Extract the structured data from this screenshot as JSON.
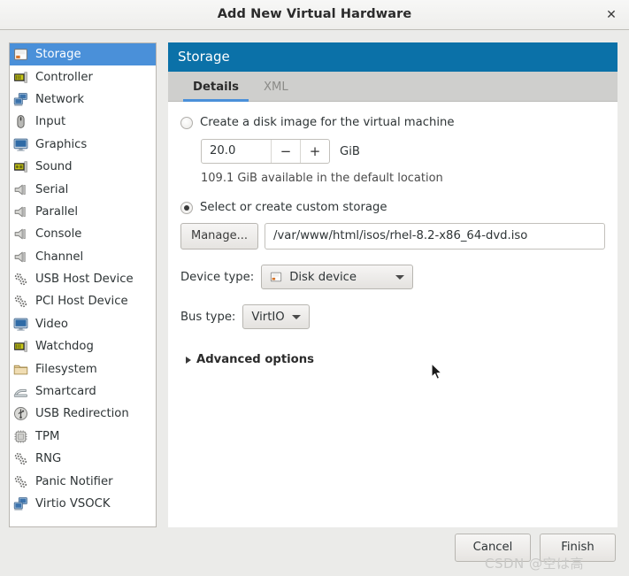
{
  "window": {
    "title": "Add New Virtual Hardware",
    "close_icon": "close-icon",
    "close_glyph": "✕"
  },
  "sidebar": {
    "items": [
      {
        "label": "Storage",
        "icon": "disk-icon",
        "selected": true
      },
      {
        "label": "Controller",
        "icon": "controller-card-icon",
        "selected": false
      },
      {
        "label": "Network",
        "icon": "network-icon",
        "selected": false
      },
      {
        "label": "Input",
        "icon": "mouse-icon",
        "selected": false
      },
      {
        "label": "Graphics",
        "icon": "monitor-icon",
        "selected": false
      },
      {
        "label": "Sound",
        "icon": "sound-card-icon",
        "selected": false
      },
      {
        "label": "Serial",
        "icon": "serial-port-icon",
        "selected": false
      },
      {
        "label": "Parallel",
        "icon": "serial-port-icon",
        "selected": false
      },
      {
        "label": "Console",
        "icon": "serial-port-icon",
        "selected": false
      },
      {
        "label": "Channel",
        "icon": "serial-port-icon",
        "selected": false
      },
      {
        "label": "USB Host Device",
        "icon": "gears-icon",
        "selected": false
      },
      {
        "label": "PCI Host Device",
        "icon": "gears-icon",
        "selected": false
      },
      {
        "label": "Video",
        "icon": "monitor-icon",
        "selected": false
      },
      {
        "label": "Watchdog",
        "icon": "controller-card-icon",
        "selected": false
      },
      {
        "label": "Filesystem",
        "icon": "folder-icon",
        "selected": false
      },
      {
        "label": "Smartcard",
        "icon": "smartcard-icon",
        "selected": false
      },
      {
        "label": "USB Redirection",
        "icon": "usb-icon",
        "selected": false
      },
      {
        "label": "TPM",
        "icon": "chip-icon",
        "selected": false
      },
      {
        "label": "RNG",
        "icon": "gears-icon",
        "selected": false
      },
      {
        "label": "Panic Notifier",
        "icon": "gears-icon",
        "selected": false
      },
      {
        "label": "Virtio VSOCK",
        "icon": "network-icon",
        "selected": false
      }
    ]
  },
  "panel": {
    "header_title": "Storage",
    "header_color": "#0b71a8",
    "accent_color": "#4a90d9",
    "tabs": [
      {
        "label": "Details",
        "active": true
      },
      {
        "label": "XML",
        "active": false
      }
    ],
    "create_disk": {
      "radio_label": "Create a disk image for the virtual machine",
      "selected": false,
      "size_value": "20.0",
      "decrement_glyph": "−",
      "increment_glyph": "+",
      "unit": "GiB",
      "available_text": "109.1 GiB available in the default location"
    },
    "custom_storage": {
      "radio_label": "Select or create custom storage",
      "selected": true,
      "manage_button": "Manage...",
      "path_value": "/var/www/html/isos/rhel-8.2-x86_64-dvd.iso",
      "path_placeholder": ""
    },
    "device_type": {
      "caption": "Device type:",
      "value": "Disk device",
      "icon": "disk-icon"
    },
    "bus_type": {
      "caption": "Bus type:",
      "value": "VirtIO"
    },
    "advanced": {
      "label": "Advanced options",
      "expanded": false
    }
  },
  "footer": {
    "cancel_label": "Cancel",
    "finish_label": "Finish"
  },
  "watermark": {
    "text": "CSDN @空は高"
  }
}
